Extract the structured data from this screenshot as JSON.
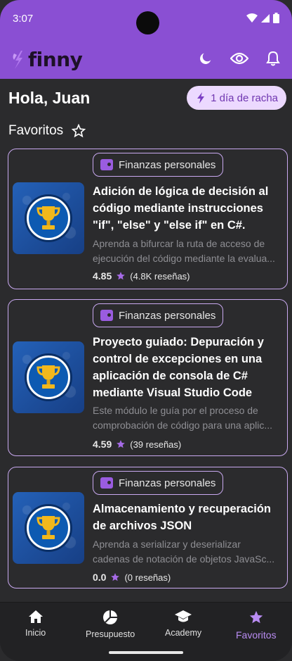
{
  "status": {
    "time": "3:07"
  },
  "app": {
    "brand": "finny"
  },
  "greeting": "Hola, Juan",
  "streak": {
    "label": "1 día de racha"
  },
  "favorites": {
    "title": "Favoritos",
    "items": [
      {
        "category": "Finanzas personales",
        "title_lines": [
          "Adición de lógica de decisión al",
          "código mediante instrucciones",
          "\"if\", \"else\" y \"else if\" en C#."
        ],
        "desc_lines": [
          "Aprenda a bifurcar la ruta de acceso de",
          "ejecución del código mediante la evalua..."
        ],
        "score": "4.85",
        "reviews": "(4.8K reseñas)"
      },
      {
        "category": "Finanzas personales",
        "title_lines": [
          "Proyecto guiado: Depuración y",
          "control de excepciones en una",
          "aplicación de consola de C#",
          "mediante Visual Studio Code"
        ],
        "desc_lines": [
          "Este módulo le guía por el proceso de",
          "comprobación de código para una aplic..."
        ],
        "score": "4.59",
        "reviews": "(39 reseñas)"
      },
      {
        "category": "Finanzas personales",
        "title_lines": [
          "Almacenamiento y recuperación",
          "de archivos JSON"
        ],
        "desc_lines": [
          "Aprenda a serializar y deserializar",
          "cadenas de notación de objetos JavaSc..."
        ],
        "score": "0.0",
        "reviews": "(0 reseñas)"
      }
    ]
  },
  "nav": {
    "items": [
      {
        "label": "Inicio",
        "icon": "home-icon"
      },
      {
        "label": "Presupuesto",
        "icon": "pie-chart-icon"
      },
      {
        "label": "Academy",
        "icon": "graduation-cap-icon"
      },
      {
        "label": "Favoritos",
        "icon": "star-icon",
        "active": true
      }
    ]
  },
  "colors": {
    "accent": "#8a4fd3",
    "chip_border": "#c9a9f0",
    "background": "#2b2b2d",
    "streak_bg": "#ecd9ff"
  }
}
